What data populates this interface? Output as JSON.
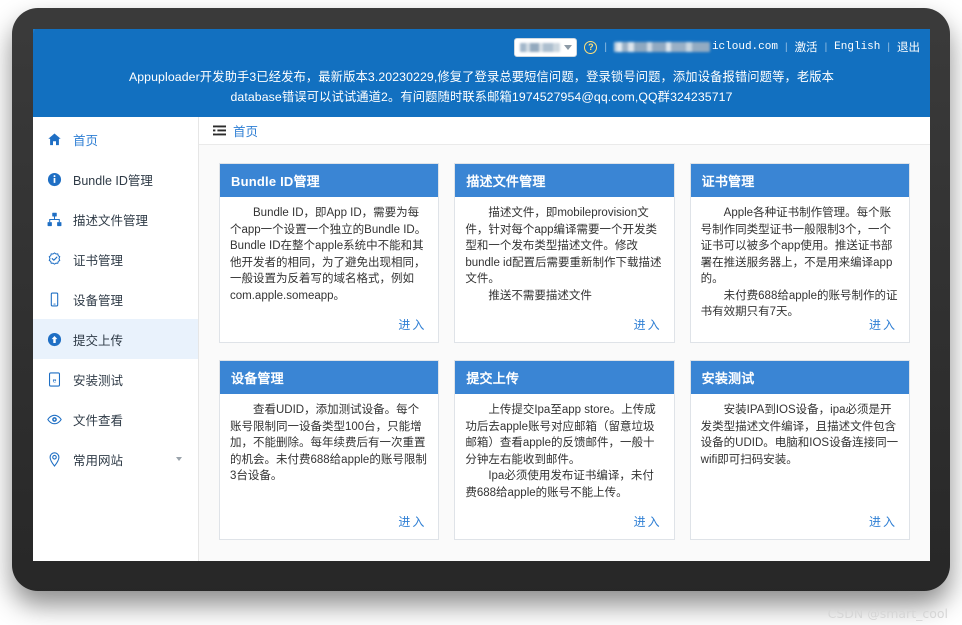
{
  "header": {
    "account_select": {
      "value_redacted": true,
      "icon": "chevron-down-icon"
    },
    "help_icon": "?",
    "account_email_suffix": "icloud.com",
    "links": [
      {
        "name": "activate",
        "label": "激活"
      },
      {
        "name": "english",
        "label": "English"
      },
      {
        "name": "logout",
        "label": "退出"
      }
    ],
    "separator": "|",
    "banner_line1": "Appuploader开发助手3已经发布，最新版本3.20230229,修复了登录总要短信问题，登录锁号问题，添加设备报错问题等，老版本",
    "banner_line2": "database错误可以试试通道2。有问题随时联系邮箱1974527954@qq.com,QQ群324235717"
  },
  "sidebar": {
    "items": [
      {
        "label": "首页",
        "icon": "home-icon",
        "active": false,
        "home": true
      },
      {
        "label": "Bundle ID管理",
        "icon": "info-icon",
        "active": false
      },
      {
        "label": "描述文件管理",
        "icon": "sitemap-icon",
        "active": false
      },
      {
        "label": "证书管理",
        "icon": "certificate-icon",
        "active": false
      },
      {
        "label": "设备管理",
        "icon": "mobile-icon",
        "active": false
      },
      {
        "label": "提交上传",
        "icon": "upload-icon",
        "active": true
      },
      {
        "label": "安装测试",
        "icon": "install-icon",
        "active": false
      },
      {
        "label": "文件查看",
        "icon": "eye-icon",
        "active": false
      },
      {
        "label": "常用网站",
        "icon": "location-icon",
        "active": false,
        "caret": true
      }
    ]
  },
  "breadcrumb": {
    "menu_icon": "menu-icon",
    "title": "首页"
  },
  "cards": [
    {
      "title": "Bundle ID管理",
      "paragraphs": [
        "Bundle ID，即App ID，需要为每个app一个设置一个独立的Bundle ID。Bundle ID在整个apple系统中不能和其他开发者的相同，为了避免出现相同，一般设置为反着写的域名格式，例如com.apple.someapp。"
      ],
      "enter_label": "进入"
    },
    {
      "title": "描述文件管理",
      "paragraphs": [
        "描述文件，即mobileprovision文件，针对每个app编译需要一个开发类型和一个发布类型描述文件。修改bundle id配置后需要重新制作下载描述文件。",
        "推送不需要描述文件"
      ],
      "enter_label": "进入"
    },
    {
      "title": "证书管理",
      "paragraphs": [
        "Apple各种证书制作管理。每个账号制作同类型证书一般限制3个，一个证书可以被多个app使用。推送证书部署在推送服务器上，不是用来编译app的。",
        "未付费688给apple的账号制作的证书有效期只有7天。"
      ],
      "enter_label": "进入"
    },
    {
      "title": "设备管理",
      "paragraphs": [
        "查看UDID，添加测试设备。每个账号限制同一设备类型100台，只能增加，不能删除。每年续费后有一次重置的机会。未付费688给apple的账号限制3台设备。"
      ],
      "enter_label": "进入"
    },
    {
      "title": "提交上传",
      "paragraphs": [
        "上传提交Ipa至app store。上传成功后去apple账号对应邮箱（留意垃圾邮箱）查看apple的反馈邮件，一般十分钟左右能收到邮件。",
        "Ipa必须使用发布证书编译，未付费688给apple的账号不能上传。"
      ],
      "enter_label": "进入"
    },
    {
      "title": "安装测试",
      "paragraphs": [
        "安装IPA到IOS设备，ipa必须是开发类型描述文件编译，且描述文件包含设备的UDID。电脑和IOS设备连接同一wifi即可扫码安装。"
      ],
      "enter_label": "进入"
    }
  ],
  "watermark": "CSDN @smart_cool",
  "colors": {
    "header_blue": "#1270c0",
    "card_head_blue": "#3a85d4",
    "link_blue": "#2f7fd4",
    "active_sidebar_bg": "#e9f2fc",
    "bezel": "#303030"
  }
}
